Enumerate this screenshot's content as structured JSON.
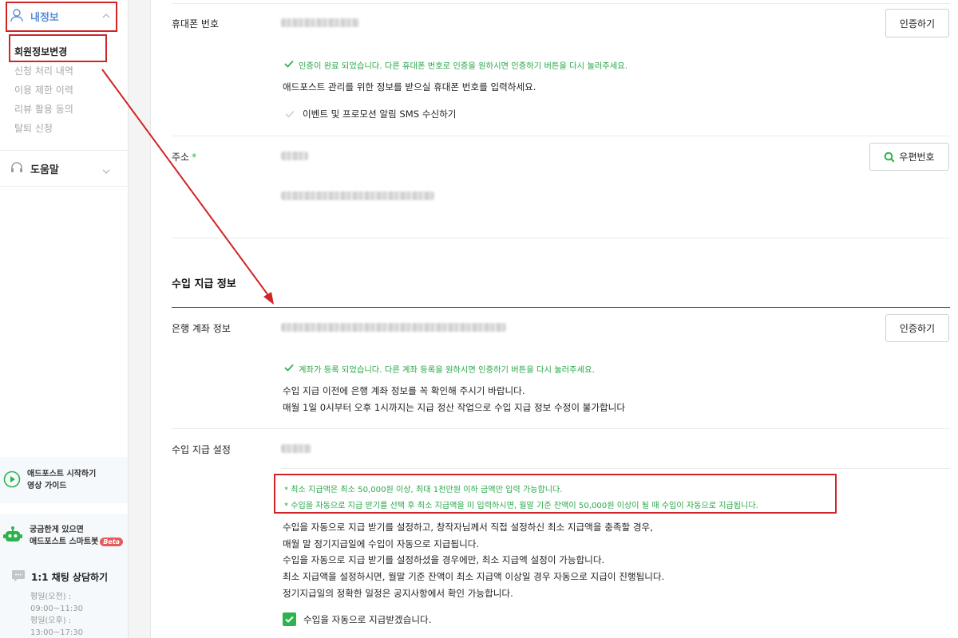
{
  "sidebar": {
    "my_info": {
      "label": "내정보",
      "icon": "person-icon"
    },
    "sub_items": [
      {
        "label": "회원정보변경",
        "active": true
      },
      {
        "label": "신청 처리 내역",
        "active": false
      },
      {
        "label": "이용 제한 이력",
        "active": false
      },
      {
        "label": "리뷰 활용 동의",
        "active": false
      },
      {
        "label": "탈퇴 신청",
        "active": false
      }
    ],
    "help": {
      "label": "도움말",
      "icon": "headset-icon"
    },
    "guide": {
      "line1": "애드포스트 시작하기",
      "line2": "영상 가이드"
    },
    "bot": {
      "line1": "궁금한게 있으면",
      "line2": "애드포스트 스마트봇",
      "badge": "Beta"
    },
    "chat": {
      "title": "1:1 채팅 상담하기",
      "hours": [
        "평일(오전) :",
        "09:00~11:30",
        "평일(오후) :",
        "13:00~17:30"
      ]
    }
  },
  "phone": {
    "label": "휴대폰 번호",
    "button": "인증하기",
    "verified_msg": "인증이 완료 되었습니다. 다른 휴대폰 번호로 인증을 원하시면 인증하기 버튼을 다시 눌러주세요.",
    "desc": "애드포스트 관리를 위한 정보를 받으실 휴대폰 번호를 입력하세요.",
    "sms_opt": "이벤트 및 프로모션 알림 SMS 수신하기"
  },
  "address": {
    "label": "주소",
    "required_mark": "*",
    "button": "우편번호"
  },
  "income": {
    "section_title": "수입 지급 정보",
    "bank": {
      "label": "은행 계좌 정보",
      "button": "인증하기",
      "registered_msg": "계좌가 등록 되었습니다. 다른 계좌 등록을 원하시면 인증하기 버튼을 다시 눌러주세요.",
      "desc1": "수입 지급 이전에 은행 계좌 정보를 꼭 확인해 주시기 바랍니다.",
      "desc2": "매월 1일 0시부터 오후 1시까지는 지급 정산 작업으로 수입 지급 정보 수정이 불가합니다"
    },
    "payout": {
      "label": "수입 지급 설정",
      "note1": "* 최소 지급액은 최소 50,000원 이상, 최대 1천만원 이하 금액만 입력 가능합니다.",
      "note2": "* 수입을 자동으로 지급 받기를 선택 후 최소 지급액을 미 입력하시면, 월말 기준 잔액이 50,000원 이상이 될 때 수입이 자동으로 지급됩니다.",
      "desc": [
        "수입을 자동으로 지급 받기를 설정하고, 창작자님께서 직접 설정하신 최소 지급액을 충족할 경우,",
        "매월 말 정기지급일에 수입이 자동으로 지급됩니다.",
        "수입을 자동으로 지급 받기를 설정하셨을 경우에만, 최소 지급액 설정이 가능합니다.",
        "최소 지급액을 설정하시면, 월말 기준 잔액이 최소 지급액 이상일 경우 자동으로 지급이 진행됩니다.",
        "정기지급일의 정확한 일정은 공지사항에서 확인 가능합니다."
      ],
      "auto_checkbox": "수입을 자동으로 지급받겠습니다."
    }
  },
  "colors": {
    "accent_green": "#2db24d",
    "annotation_red": "#d02427",
    "link_blue": "#5b8dd6"
  }
}
